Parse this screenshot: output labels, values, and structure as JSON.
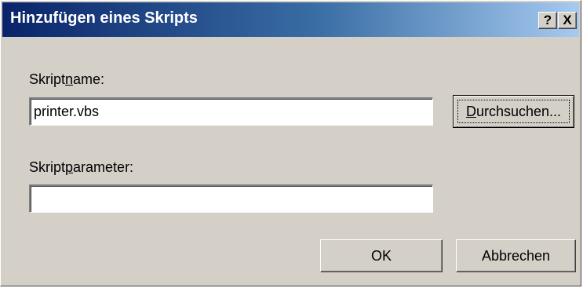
{
  "window": {
    "title": "Hinzufügen eines Skripts",
    "help_glyph": "?",
    "close_glyph": "X"
  },
  "form": {
    "script_name": {
      "label_pre": "Skript",
      "label_accel": "n",
      "label_post": "ame:",
      "value": "printer.vbs"
    },
    "script_params": {
      "label_pre": "Skript",
      "label_accel": "p",
      "label_post": "arameter:",
      "value": ""
    }
  },
  "buttons": {
    "browse_accel": "D",
    "browse_rest": "urchsuchen...",
    "ok": "OK",
    "cancel": "Abbrechen"
  },
  "colors": {
    "titlebar_start": "#0a246a",
    "titlebar_end": "#a6caf0",
    "face": "#d4d0c8"
  },
  "icons": {
    "help": "question-mark-icon",
    "close": "close-x-icon"
  }
}
